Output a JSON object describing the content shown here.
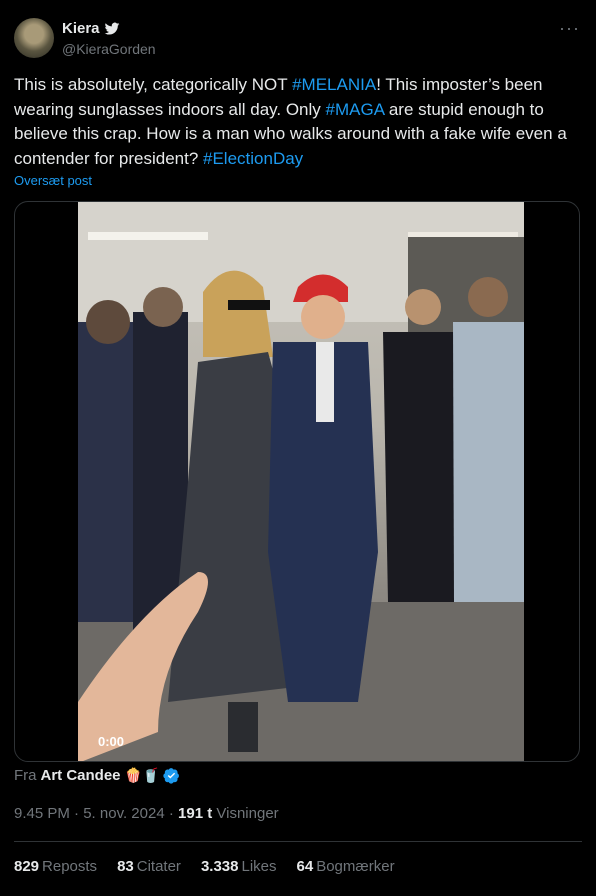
{
  "author": {
    "display_name": "Kiera",
    "handle": "@KieraGorden",
    "badge_icon": "twitter-bird-icon"
  },
  "menu": {
    "more_label": "···"
  },
  "tweet": {
    "segments": [
      {
        "text": "This is absolutely, categorically NOT ",
        "type": "text"
      },
      {
        "text": "#MELANIA",
        "type": "hashtag"
      },
      {
        "text": "! This imposter’s been wearing sunglasses indoors all day. Only ",
        "type": "text"
      },
      {
        "text": "#MAGA",
        "type": "hashtag"
      },
      {
        "text": " are stupid enough to believe this crap. How is a man who walks around with a fake wife even a contender for president? ",
        "type": "text"
      },
      {
        "text": "#ElectionDay",
        "type": "hashtag"
      }
    ],
    "translate_label": "Oversæt post"
  },
  "media": {
    "video_time": "0:00"
  },
  "attribution": {
    "prefix": "Fra",
    "source_name": "Art Candee",
    "emojis": "🍿🥤"
  },
  "meta": {
    "time": "9.45 PM",
    "separator": "·",
    "date": "5. nov. 2024",
    "views_count": "191 t",
    "views_label": "Visninger"
  },
  "stats": {
    "reposts_count": "829",
    "reposts_label": "Reposts",
    "quotes_count": "83",
    "quotes_label": "Citater",
    "likes_count": "3.338",
    "likes_label": "Likes",
    "bookmarks_count": "64",
    "bookmarks_label": "Bogmærker"
  },
  "colors": {
    "background": "#000000",
    "text": "#e7e9ea",
    "muted": "#71767b",
    "accent": "#1d9bf0",
    "border": "#2f3336"
  }
}
